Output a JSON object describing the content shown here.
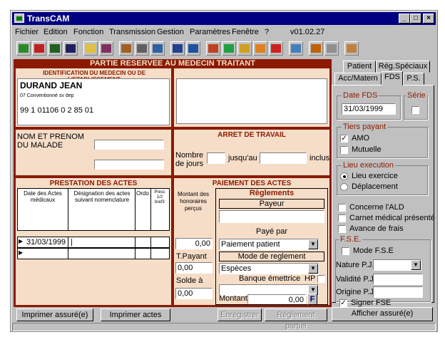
{
  "window": {
    "title": "TransCAM",
    "minimize": "_",
    "maximize": "□",
    "close": "×"
  },
  "menu": [
    "Fichier",
    "Edition",
    "Fonction",
    "Transmission",
    "Gestion",
    "Paramètres",
    "Fenêtre",
    "?"
  ],
  "version": "v01.02.27",
  "banner": "PARTIE RESERVEE AU MEDECIN TRAITANT",
  "identification": {
    "title": "IDENTIFICATION DU MEDECIN OU DE L'ETABLISSEMENT",
    "name": "DURAND JEAN",
    "convention": "07  Conventionné sv dep",
    "number": "99 1 01106 0 2 85  01"
  },
  "patient": {
    "label": "NOM ET PRENOM DU MALADE"
  },
  "arret": {
    "title": "ARRET DE TRAVAIL",
    "nombre": "Nombre de jours",
    "jusquau": "jusqu'au",
    "inclus": "inclus"
  },
  "prestation": {
    "title": "PRESTATION DES ACTES",
    "col_date": "Date des Actes médicaux",
    "col_designation": "Désignation des actes suivant nomenclature",
    "col_ordo": "Ordo",
    "col_presc": "Presc 1/2 bref3",
    "row1_date": "31/03/1999",
    "row1_desig": "|"
  },
  "paiement": {
    "title": "PAIEMENT DES ACTES",
    "montant_label": "Montant des honoraires perçus",
    "montant": "0,00",
    "tpayant_label": "T.Payant",
    "tpayant": "0,00",
    "solde_label": "Solde à",
    "solde": "0,00",
    "reglements": "Règlements",
    "payeur": "Payeur",
    "paye_par": "Payé par",
    "paye_par_value": "Paiement patient",
    "mode": "Mode de reglement",
    "mode_value": "Espèces",
    "banque": "Banque émettrice",
    "hp": "HP",
    "montant2": "Montant",
    "montant2_value": "0,00",
    "f": "F"
  },
  "tabs": {
    "patient": "Patient",
    "reg": "Rég.Spéciaux",
    "acc": "Acc/Matern",
    "fds": "FDS",
    "ps": "P.S."
  },
  "right": {
    "date_fds_label": "Date FDS",
    "date_fds": "31/03/1999",
    "serie": "Série",
    "tiers": "Tiers payant",
    "amo": "AMO",
    "mutuelle": "Mutuelle",
    "lieu": "Lieu execution",
    "lieu_exercice": "Lieu exercice",
    "deplacement": "Déplacement",
    "ald": "Concerne l'ALD",
    "carnet": "Carnet médical présenté",
    "avance": "Avance de frais",
    "fse": "F.S.E.",
    "mode_fse": "Mode F.S.E",
    "nature": "Nature P.J.",
    "validite": "Validité P.J.",
    "origine": "Origine P.J.",
    "signer": "Signer FSE"
  },
  "buttons": {
    "imprimer_assure": "Imprimer assuré(e)",
    "imprimer_actes": "Imprimer actes",
    "enregistrer": "Enregistrer",
    "reglement_partiel": "Règlement partiel",
    "afficher": "Afficher assuré(e)"
  }
}
